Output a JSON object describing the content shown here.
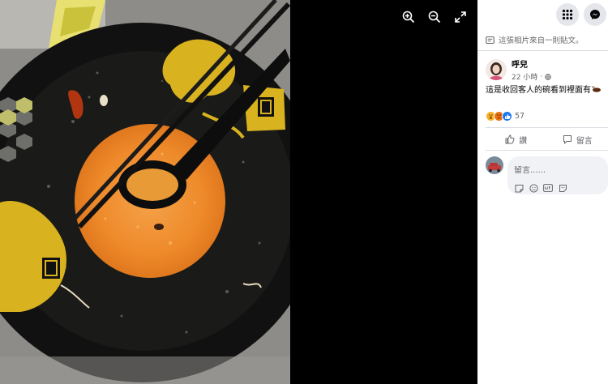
{
  "viewer": {
    "tools": [
      {
        "icon": "zoom-in-icon"
      },
      {
        "icon": "zoom-out-icon"
      },
      {
        "icon": "fullscreen-icon"
      }
    ]
  },
  "header": {
    "menu_icon": "grid-menu-icon",
    "messenger_icon": "messenger-icon"
  },
  "post": {
    "from_post_label": "這張相片來自一則貼文。",
    "author_name": "呼兒",
    "time": "22 小時",
    "privacy_icon": "globe-icon",
    "text": "這是收回客人的碗看到裡面有",
    "text_emoji_icon": "cockroach-icon",
    "reactions": [
      "wow",
      "angry",
      "like"
    ],
    "reaction_count": "57"
  },
  "actions": {
    "like_label": "讚",
    "comment_label": "留言"
  },
  "comment": {
    "placeholder": "留言......",
    "tool_icons": [
      "sticker-icon",
      "emoji-icon",
      "gif-icon",
      "camera-sticker-icon"
    ]
  },
  "colors": {
    "sidebar_bg": "#ffffff",
    "secondary_text": "#65676b",
    "button_bg": "#e4e6eb",
    "comment_bg": "#f0f2f5",
    "like_blue": "#1877f2"
  }
}
